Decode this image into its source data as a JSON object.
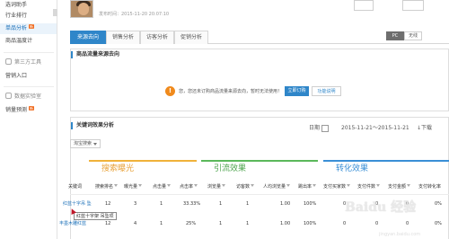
{
  "sidebar": {
    "items": [
      {
        "label": "选词助手"
      },
      {
        "label": "行业排行"
      },
      {
        "label": "单品分析",
        "badge": "新"
      },
      {
        "label": "商品温度计"
      }
    ],
    "sections": [
      {
        "label": "第三方工具",
        "items": [
          {
            "label": "营销入口"
          }
        ]
      },
      {
        "label": "数据实验室",
        "items": [
          {
            "label": "销量预测",
            "badge": "新"
          }
        ]
      }
    ]
  },
  "product": {
    "publish_time": "发布时间：2015-11-20 20:07:10"
  },
  "tabs": [
    {
      "label": "来源去向",
      "active": true
    },
    {
      "label": "销售分析"
    },
    {
      "label": "访客分析"
    },
    {
      "label": "促销分析"
    }
  ],
  "device_toggle": {
    "pc": "PC",
    "wireless": "无线"
  },
  "flow_panel": {
    "title": "商品流量来源去向",
    "notice": "您，您还未订购商品流量来源去向，暂时无法使用！",
    "subscribe_button": "立即订购",
    "detail_button": "功能说明"
  },
  "keyword_panel": {
    "title": "关键词效果分析",
    "date_label": "日期",
    "date_range": "2015-11-21～2015-11-21",
    "download": "下载",
    "source_select": "淘宝搜索",
    "groups": [
      "搜索曝光",
      "引流效果",
      "转化效果"
    ],
    "columns": [
      "关键词",
      "搜索排名",
      "曝光量",
      "点击量",
      "点击率",
      "浏览量",
      "访客数",
      "人均浏览量",
      "跳出率",
      "支付买家数",
      "支付件数",
      "支付金额",
      "支付转化率"
    ],
    "rows": [
      {
        "keyword": "红蓝十字吊 坠",
        "values": [
          "12",
          "3",
          "1",
          "33.33%",
          "1",
          "1",
          "1.00",
          "100%",
          "0",
          "0",
          "0",
          "0%"
        ]
      },
      {
        "keyword": "丰墨木雕红蓝",
        "values": [
          "12",
          "4",
          "1",
          "25%",
          "1",
          "1",
          "1.00",
          "100%",
          "0",
          "0",
          "0",
          "0%"
        ]
      }
    ],
    "tooltip": "红蓝十字架 吊坠项"
  },
  "watermark": {
    "brand": "Baidu 经验",
    "sub": "经验",
    "url": "jingyan.baidu.com"
  },
  "colors": {
    "accent": "#2f86c9",
    "orange": "#f08a1c",
    "green": "#4ca34c"
  }
}
